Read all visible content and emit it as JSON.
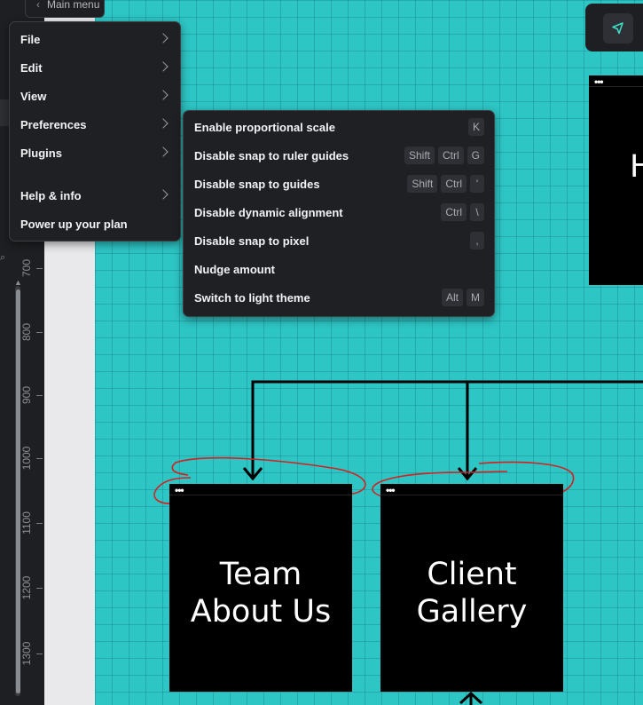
{
  "main_menu_tab": {
    "label": "Main menu"
  },
  "main_menu": {
    "items": [
      {
        "label": "File"
      },
      {
        "label": "Edit"
      },
      {
        "label": "View"
      },
      {
        "label": "Preferences"
      },
      {
        "label": "Plugins"
      },
      {
        "label": "Help & info"
      },
      {
        "label": "Power up your plan"
      }
    ]
  },
  "preferences_submenu": {
    "items": [
      {
        "label": "Enable proportional scale",
        "shortcut": [
          "K"
        ]
      },
      {
        "label": "Disable snap to ruler guides",
        "shortcut": [
          "Shift",
          "Ctrl",
          "G"
        ]
      },
      {
        "label": "Disable snap to guides",
        "shortcut": [
          "Shift",
          "Ctrl",
          "'"
        ]
      },
      {
        "label": "Disable dynamic alignment",
        "shortcut": [
          "Ctrl",
          "\\"
        ]
      },
      {
        "label": "Disable snap to pixel",
        "shortcut": [
          ","
        ]
      },
      {
        "label": "Nudge amount",
        "shortcut": []
      },
      {
        "label": "Switch to light theme",
        "shortcut": [
          "Alt",
          "M"
        ]
      }
    ]
  },
  "ruler": {
    "labels": [
      "700",
      "800",
      "900",
      "1000",
      "1100",
      "1200",
      "1300"
    ]
  },
  "frames": {
    "home": {
      "title_partial": "H",
      "dots": "•••"
    },
    "team": {
      "line1": "Team",
      "line2": "About Us",
      "dots": "•••"
    },
    "gallery": {
      "line1": "Client",
      "line2": "Gallery",
      "dots": "•••"
    }
  },
  "toolbar": {
    "tool_icon": "pointer-icon"
  },
  "colors": {
    "canvas": "#2ec5c5",
    "menu_bg": "#1f2024",
    "annotation": "#d42020"
  }
}
